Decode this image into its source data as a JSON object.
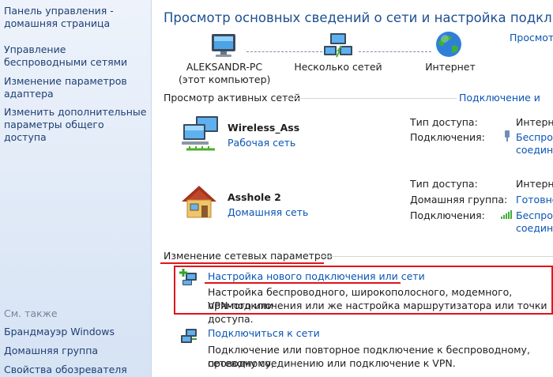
{
  "sidebar": {
    "home": "Панель управления - домашняя страница",
    "items": [
      "Управление беспроводными сетями",
      "Изменение параметров адаптера",
      "Изменить дополнительные параметры общего доступа"
    ],
    "see_also_label": "См. также",
    "see_also": [
      "Брандмауэр Windows",
      "Домашняя группа",
      "Свойства обозревателя"
    ]
  },
  "header": {
    "title": "Просмотр основных сведений о сети и настройка подключений",
    "view_full_map": "Просмотр"
  },
  "network_map": {
    "computer_name": "ALEKSANDR-PC",
    "computer_sub": "(этот компьютер)",
    "middle": "Несколько сетей",
    "internet": "Интернет"
  },
  "active_networks": {
    "heading": "Просмотр активных сетей",
    "connect_disconnect": "Подключение и",
    "networks": [
      {
        "name": "Wireless_Ass",
        "type": "Рабочая сеть",
        "access_label": "Тип доступа:",
        "access_value": "Интерне",
        "connections_label": "Подключения:",
        "connections_value_1": "Беспров",
        "connections_value_2": "соедине"
      },
      {
        "name": "Asshole  2",
        "type": "Домашняя сеть",
        "access_label": "Тип доступа:",
        "access_value": "Интерне",
        "homegroup_label": "Домашняя группа:",
        "homegroup_value": "Готовно",
        "connections_label": "Подключения:",
        "connections_value_1": "Беспров",
        "connections_value_2": "соедине"
      }
    ]
  },
  "change_settings": {
    "heading": "Изменение сетевых параметров",
    "tasks": [
      {
        "title": "Настройка нового подключения или сети",
        "desc_1": "Настройка беспроводного, широкополосного, модемного, прямого или",
        "desc_2": "VPN-подключения или же настройка маршрутизатора или точки доступа."
      },
      {
        "title": "Подключиться к сети",
        "desc_1": "Подключение или повторное подключение к беспроводному, проводному,",
        "desc_2": "сетевому соединению или подключение к VPN."
      }
    ]
  },
  "colors": {
    "highlight_red": "#e2141b",
    "link_blue": "#0a55b5",
    "title_blue": "#1d4f91",
    "sidebar_bg": "#dfe9f7"
  }
}
